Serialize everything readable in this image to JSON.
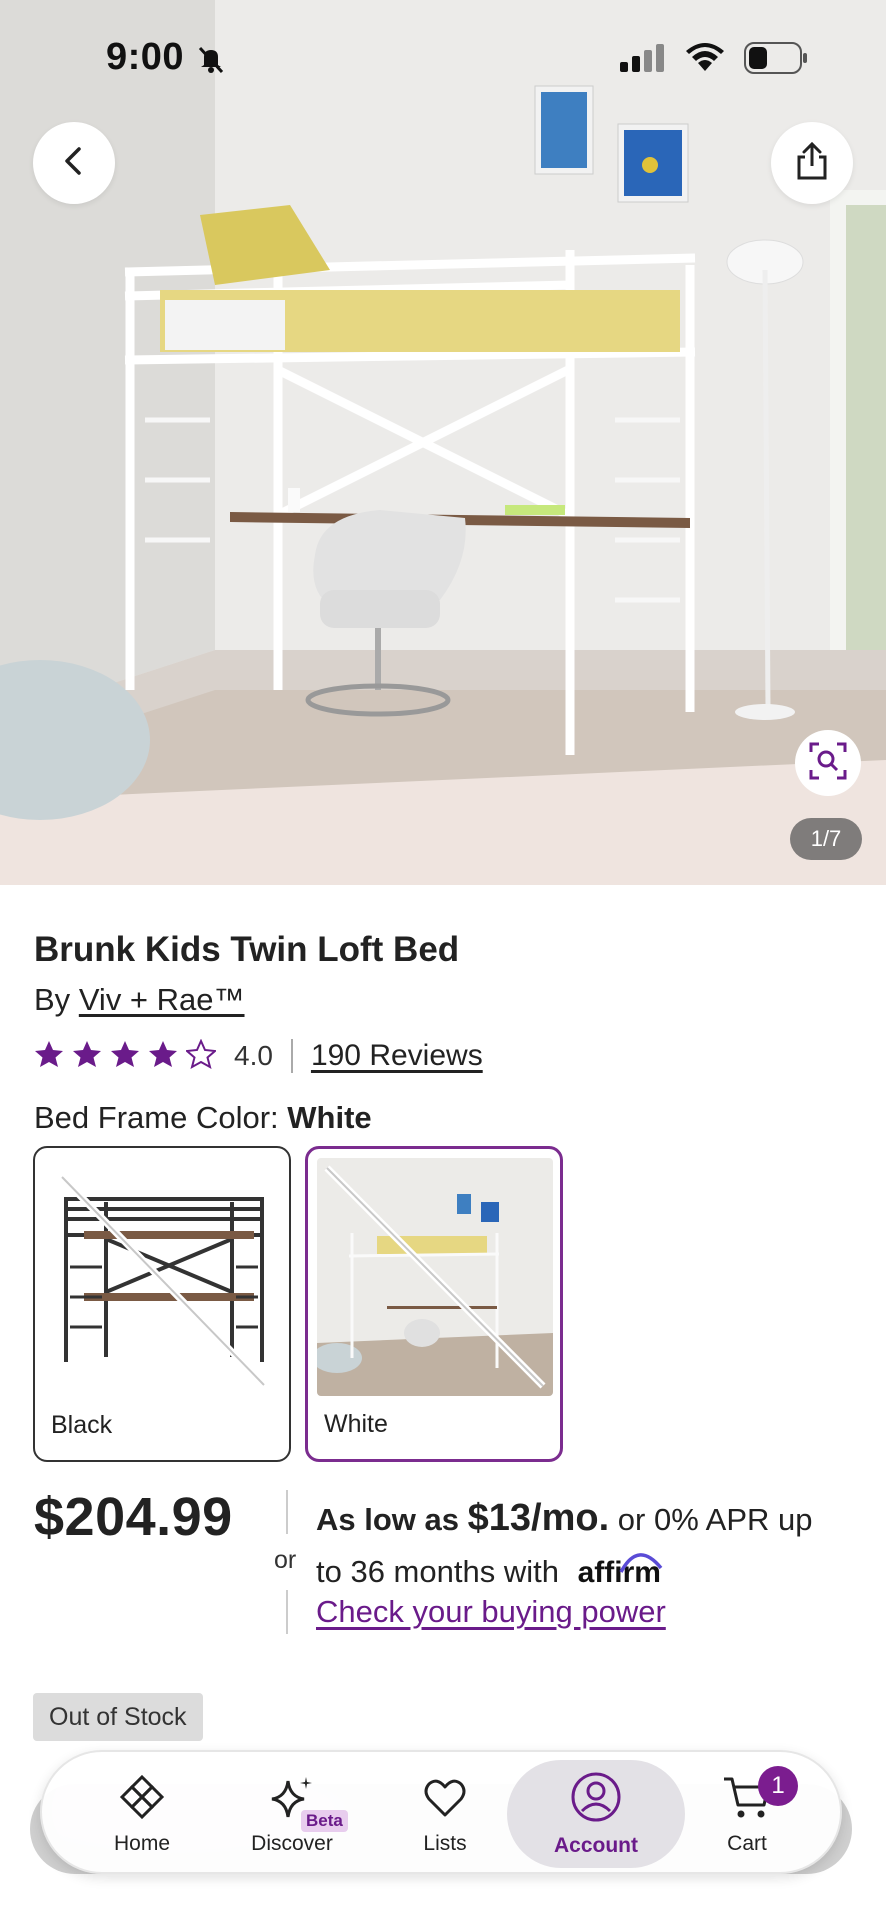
{
  "status_bar": {
    "time": "9:00"
  },
  "gallery": {
    "counter": "1/7"
  },
  "product": {
    "title": "Brunk Kids Twin Loft Bed",
    "by_prefix": "By",
    "brand": "Viv + Rae™",
    "rating_value": "4.0",
    "rating_stars": 4,
    "rating_max": 5,
    "reviews_link": "190 Reviews"
  },
  "options": {
    "label": "Bed Frame Color:",
    "selected": "White",
    "swatches": [
      {
        "label": "Black",
        "selected": false,
        "unavailable": true
      },
      {
        "label": "White",
        "selected": true,
        "unavailable": true
      }
    ]
  },
  "pricing": {
    "price": "$204.99",
    "or": "or",
    "financing_prefix": "As low as",
    "financing_amount": "$13/mo.",
    "financing_mid": "or 0% APR up",
    "financing_line2": "to 36 months with",
    "affirm": "affirm",
    "buying_power_link": "Check your buying power"
  },
  "stock": {
    "status": "Out of Stock"
  },
  "bottom_nav": {
    "items": [
      {
        "label": "Home",
        "icon": "home-diamond-icon"
      },
      {
        "label": "Discover",
        "icon": "sparkle-icon",
        "badge": "Beta"
      },
      {
        "label": "Lists",
        "icon": "heart-icon"
      },
      {
        "label": "Account",
        "icon": "account-icon",
        "active": true
      },
      {
        "label": "Cart",
        "icon": "cart-icon",
        "count": "1"
      }
    ]
  },
  "colors": {
    "accent": "#7b2c8f",
    "star": "#6a1b8a",
    "badge_bg": "#dcdcdc"
  }
}
